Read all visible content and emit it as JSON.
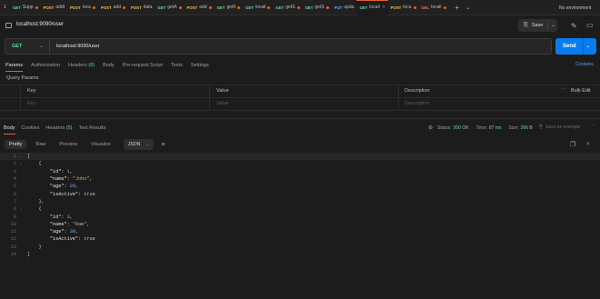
{
  "tabs": {
    "lead": "1",
    "items": [
      {
        "method": "GET",
        "name": "Supp",
        "color": "#6bdd9a",
        "dot": true
      },
      {
        "method": "POST",
        "name": "addt",
        "color": "#f0c24a",
        "dot": false
      },
      {
        "method": "POST",
        "name": "loca",
        "color": "#f0c24a",
        "dot": true
      },
      {
        "method": "POST",
        "name": "add",
        "color": "#f0c24a",
        "dot": true
      },
      {
        "method": "POST",
        "name": "data",
        "color": "#f0c24a",
        "dot": false
      },
      {
        "method": "GET",
        "name": "getA",
        "color": "#6bdd9a",
        "dot": true
      },
      {
        "method": "POST",
        "name": "add",
        "color": "#f0c24a",
        "dot": true
      },
      {
        "method": "GET",
        "name": "getIt",
        "color": "#6bdd9a",
        "dot": true
      },
      {
        "method": "GET",
        "name": "locall",
        "color": "#6bdd9a",
        "dot": true
      },
      {
        "method": "GET",
        "name": "getS",
        "color": "#6bdd9a",
        "dot": true
      },
      {
        "method": "GET",
        "name": "getS",
        "color": "#6bdd9a",
        "dot": true
      },
      {
        "method": "PUT",
        "name": "upda",
        "color": "#6fa8e6",
        "dot": false
      },
      {
        "method": "GET",
        "name": "locall",
        "color": "#6bdd9a",
        "dot": false,
        "active": true
      },
      {
        "method": "POST",
        "name": "loca",
        "color": "#f0c24a",
        "dot": true
      },
      {
        "method": "DEL",
        "name": "locall",
        "color": "#ef6b73",
        "dot": true
      }
    ],
    "add_label": "+",
    "overflow_label": "⌄",
    "environment": "No environment"
  },
  "request": {
    "title": "localhost:9090/user",
    "save_label": "Save",
    "method": "GET",
    "method_color": "#6bdd9a",
    "url": "localhost:9090/user",
    "send_label": "Send",
    "accent": "#097bed"
  },
  "request_tabs": [
    {
      "label": "Params",
      "count": "",
      "active": true
    },
    {
      "label": "Authorization",
      "count": "",
      "active": false
    },
    {
      "label": "Headers",
      "count": "(6)",
      "active": false
    },
    {
      "label": "Body",
      "count": "",
      "active": false
    },
    {
      "label": "Pre-request Script",
      "count": "",
      "active": false
    },
    {
      "label": "Tests",
      "count": "",
      "active": false
    },
    {
      "label": "Settings",
      "count": "",
      "active": false
    }
  ],
  "cookies_link": "Cookies",
  "query_params": {
    "label": "Query Params",
    "headers": {
      "key": "Key",
      "value": "Value",
      "description": "Description",
      "bulk_edit": "Bulk Edit"
    },
    "placeholders": {
      "key": "Key",
      "value": "Value",
      "description": "Description"
    }
  },
  "response": {
    "tabs": [
      {
        "label": "Body",
        "count": "",
        "active": true
      },
      {
        "label": "Cookies",
        "count": "",
        "active": false
      },
      {
        "label": "Headers",
        "count": "(5)",
        "active": false
      },
      {
        "label": "Test Results",
        "count": "",
        "active": false
      }
    ],
    "status_label": "Status:",
    "status_value": "200 OK",
    "time_label": "Time:",
    "time_value": "87 ms",
    "size_label": "Size:",
    "size_value": "266 B",
    "save_example": "Save as example",
    "formats": [
      "Pretty",
      "Raw",
      "Preview",
      "Visualize"
    ],
    "active_format": "Pretty",
    "language": "JSON"
  },
  "code_lines": [
    {
      "num": "1",
      "fold": "⌄",
      "text": "[",
      "hl": true
    },
    {
      "num": "2",
      "fold": "⌄",
      "text": "    {"
    },
    {
      "num": "3",
      "fold": "",
      "text": "        \"id\": 1,"
    },
    {
      "num": "4",
      "fold": "",
      "text": "        \"name\": \"John\","
    },
    {
      "num": "5",
      "fold": "",
      "text": "        \"age\": 29,"
    },
    {
      "num": "6",
      "fold": "",
      "text": "        \"isActive\": true"
    },
    {
      "num": "7",
      "fold": "",
      "text": "    },"
    },
    {
      "num": "8",
      "fold": "⌄",
      "text": "    {"
    },
    {
      "num": "9",
      "fold": "",
      "text": "        \"id\": 3,"
    },
    {
      "num": "10",
      "fold": "",
      "text": "        \"name\": \"Ram\","
    },
    {
      "num": "11",
      "fold": "",
      "text": "        \"age\": 30,"
    },
    {
      "num": "12",
      "fold": "",
      "text": "        \"isActive\": true"
    },
    {
      "num": "13",
      "fold": "",
      "text": "    }"
    },
    {
      "num": "14",
      "fold": "",
      "text": "]"
    }
  ]
}
